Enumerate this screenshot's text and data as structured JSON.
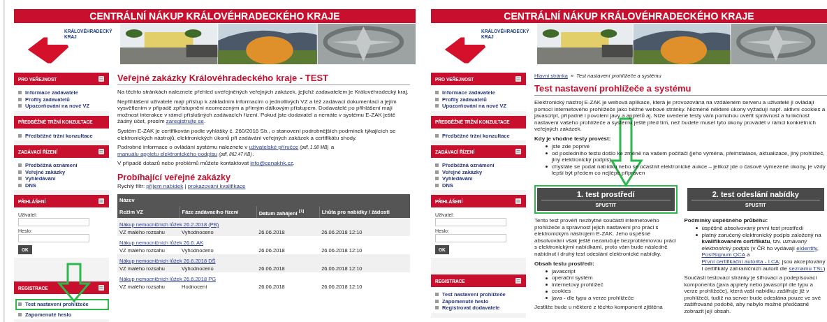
{
  "panels": [
    {
      "header": "CENTRÁLNÍ NÁKUP KRÁLOVÉHRADECKÉHO KRAJE",
      "logo_lines": [
        "KRÁLOVÉHRADECKÝ",
        "KRAJ"
      ],
      "sidebar": [
        {
          "kind": "links",
          "title": "PRO VEŘEJNOST",
          "icon": true,
          "items": [
            {
              "label": "Informace zadavatele",
              "highlighted": false
            },
            {
              "label": "Profily zadavatelů",
              "highlighted": false
            },
            {
              "label": "Upozorňování na nové VZ",
              "highlighted": false
            }
          ]
        },
        {
          "kind": "links",
          "title": "PŘEDBĚŽNÉ TRŽNÍ KONZULTACE",
          "icon": false,
          "items": [
            {
              "label": "Předběžné tržní konzultace",
              "highlighted": false
            }
          ]
        },
        {
          "kind": "links",
          "title": "ZADÁVACÍ ŘÍZENÍ",
          "icon": true,
          "items": [
            {
              "label": "Předběžná oznámení",
              "highlighted": false
            },
            {
              "label": "Veřejné zakázky",
              "highlighted": false
            },
            {
              "label": "Vyhledávání",
              "highlighted": false
            },
            {
              "label": "DNS",
              "highlighted": false
            }
          ]
        },
        {
          "kind": "login",
          "title": "PŘIHLÁŠENÍ",
          "icon": true,
          "fields": [
            {
              "label": "Uživatel:"
            },
            {
              "label": "Heslo:"
            }
          ],
          "button": "OK"
        },
        {
          "kind": "links",
          "title": "REGISTRACE",
          "icon": true,
          "items": [
            {
              "label": "Test nastavení prohlížeče",
              "highlighted": true
            },
            {
              "label": "Zapomenuté heslo",
              "highlighted": false
            }
          ]
        }
      ],
      "content": [
        {
          "kind": "title",
          "text": "Veřejné zakázky Královéhradeckého kraje - TEST"
        },
        {
          "kind": "para",
          "parts": [
            {
              "kind": "text",
              "text": "Na těchto stránkách naleznete přehled uveřejněných veřejných zakázek, jejichž zadavatelem je Královéhradecký kraj."
            }
          ]
        },
        {
          "kind": "para",
          "parts": [
            {
              "kind": "text",
              "text": "Nepřihlášení uživatelé mají přístup k základním informacím o jednotlivých VZ a též zadávací dokumentaci a jejím vysvětlením v případě zpřístupnění neomezeným a přímým dálkovým přístupem. Dodavatelé po přihlášení mají možnost interakce v rámci příslušných zadávacích řízení. Pokud jste dodavatel a nemáte v systému E-ZAK ještě žádný účet, prosím "
            },
            {
              "kind": "link",
              "text": "zaregistrujte se"
            },
            {
              "kind": "text",
              "text": "."
            }
          ]
        },
        {
          "kind": "para",
          "parts": [
            {
              "kind": "text",
              "text": "Systém E-ZAK je certifikován podle vyhlášky č. 260/2016 Sb., o stanovení podrobnějších podmínek týkajících se elektronických nástrojů, elektronických úkonů při zadávání veřejných zakázek a certifikátu shody."
            }
          ]
        },
        {
          "kind": "para",
          "parts": [
            {
              "kind": "text",
              "text": "Podrobné informace o ovládání systému naleznete v "
            },
            {
              "kind": "link",
              "text": "uživatelské příručce"
            },
            {
              "kind": "note",
              "text": "(pdf, 1.98 MB)"
            },
            {
              "kind": "text",
              "text": " a "
            },
            {
              "kind": "link",
              "text": "manuálu appletu elektronického podpisu"
            },
            {
              "kind": "note",
              "text": "(pdf, 862.47 KB)"
            },
            {
              "kind": "text",
              "text": "."
            }
          ]
        },
        {
          "kind": "para",
          "parts": [
            {
              "kind": "text",
              "text": "V případě dotazů nebo problémů můžete kontaktovat "
            },
            {
              "kind": "link",
              "text": "info@cenakhk.cz"
            },
            {
              "kind": "text",
              "text": "."
            }
          ]
        },
        {
          "kind": "subtitle",
          "text": "Probíhající veřejné zakázky"
        },
        {
          "kind": "filter",
          "parts": [
            {
              "kind": "text",
              "text": "Rychlý filtr: "
            },
            {
              "kind": "link",
              "text": "příjem nabídek"
            },
            {
              "kind": "text",
              "text": " | "
            },
            {
              "kind": "link",
              "text": "prokazování kvalifikace"
            }
          ]
        },
        {
          "kind": "table",
          "caption": "Název",
          "columns": [
            "Režim VZ",
            "Fáze zadávacího řízení",
            "Datum zahájení $^{[1]}$",
            "Lhůta pro nabídky / žádosti"
          ],
          "rows": [
            {
              "name": "Nákup nemocničních lůžek 26.2.2018 (PB)",
              "cells": [
                "VZ malého rozsahu",
                "Vyhodnoceno",
                "26.06.2018",
                "26.06.2018 12:10"
              ]
            },
            {
              "name": "Nákup nemocničních lůžek 26.6. AK",
              "cells": [
                "VZ malého rozsahu",
                "Vyhodnoceno",
                "26.06.2018",
                "26.06.2018 12:10"
              ]
            },
            {
              "name": "Nákup nemocničních lůžek 26.6.2018 DŠ",
              "cells": [
                "VZ malého rozsahu",
                "Vyhodnoceno",
                "26.06.2018",
                "26.06.2018 12:10"
              ]
            },
            {
              "name": "Nákup nemocničních lůžek 26.6.2018 PG",
              "cells": [
                "VZ malého rozsahu",
                "Hodnocení",
                "26.06.2018",
                "26.06.2018 12:10"
              ]
            }
          ]
        }
      ]
    },
    {
      "header": "CENTRÁLNÍ NÁKUP KRÁLOVÉHRADECKÉHO KRAJE",
      "logo_lines": [
        "KRÁLOVÉHRADECKÝ",
        "KRAJ"
      ],
      "sidebar": [
        {
          "kind": "links",
          "title": "PRO VEŘEJNOST",
          "icon": true,
          "items": [
            {
              "label": "Informace zadavatele",
              "highlighted": false
            },
            {
              "label": "Profily zadavatelů",
              "highlighted": false
            },
            {
              "label": "Upozorňování na nové VZ",
              "highlighted": false
            }
          ]
        },
        {
          "kind": "links",
          "title": "PŘEDBĚŽNÉ TRŽNÍ KONZULTACE",
          "icon": false,
          "items": [
            {
              "label": "Předběžné tržní konzultace",
              "highlighted": false
            }
          ]
        },
        {
          "kind": "links",
          "title": "ZADÁVACÍ ŘÍZENÍ",
          "icon": true,
          "items": [
            {
              "label": "Předběžná oznámení",
              "highlighted": false
            },
            {
              "label": "Veřejné zakázky",
              "highlighted": false
            },
            {
              "label": "Vyhledávání",
              "highlighted": false
            },
            {
              "label": "DNS",
              "highlighted": false
            }
          ]
        },
        {
          "kind": "login",
          "title": "PŘIHLÁŠENÍ",
          "icon": true,
          "fields": [
            {
              "label": "Uživatel:"
            },
            {
              "label": "Heslo:"
            }
          ],
          "button": "OK"
        },
        {
          "kind": "links",
          "title": "REGISTRACE",
          "icon": true,
          "items": [
            {
              "label": "Test nastavení prohlížeče",
              "highlighted": false
            },
            {
              "label": "Zapomenuté heslo",
              "highlighted": false
            },
            {
              "label": "Registrovat dodavatele",
              "highlighted": false
            }
          ]
        }
      ],
      "content": [
        {
          "kind": "breadcrumb",
          "link": "Hlavní stránka",
          "separator": "»",
          "current": "Test nastavení prohlížeče a systému"
        },
        {
          "kind": "title",
          "text": "Test nastavení prohlížeče a systému"
        },
        {
          "kind": "para",
          "parts": [
            {
              "kind": "text",
              "text": "Elektronický nástroj E-ZAK je webová aplikace, která je provozována na vzdáleném serveru a uživatelé ji ovládají pomocí internetového prohlížeče jako běžné webové stránky. Nicméně některé úkony vyžadují např. aktivní cookies a javascript, případně i povolení javy a appletů aj. Níže uvedené testy vám pomohou ověřit správnost a funkčnost nastavení vašeho prohlížeče a systému ještě před tím, než budete muset tyto úkony provádět v rámci konkrétních veřejných zakázek."
            }
          ]
        },
        {
          "kind": "label",
          "text": "Kdy je vhodné testy provést:"
        },
        {
          "kind": "list",
          "items": [
            "jste zde poprvé",
            "od posledního testu došlo ke změně na vašem počítači (jeho výměna, přeinstalace, aktualizace, jiný prohlížeč, jiný elektronický podpis)",
            "chystáte se podat nabídku nebo se účastnit elektronické aukce – jelikož jde o časově vymezené úkony, je vždy lepší být předem co nejlépe připraven"
          ]
        },
        {
          "kind": "tests",
          "columns": [
            {
              "title": "1. test prostředí",
              "button": "SPUSTIT",
              "highlighted": true,
              "blocks": [
                {
                  "kind": "para",
                  "parts": [
                    {
                      "kind": "text",
                      "text": "Tento test prověří nezbytné součásti internetového prohlížeče a správnost jejich nastavení pro práci s elektronickým nástrojem E-ZAK. Jeho úspěšné absolvování však ještě nezaručuje bezproblémovou práci s elektronickými nabídkami, proto vám bude následně nabídnut i druhý test odeslání elektronické nabídky."
                    }
                  ]
                },
                {
                  "kind": "label",
                  "text": "Obsah testu prostředí:"
                },
                {
                  "kind": "list",
                  "items": [
                    "javascript",
                    "operační systém",
                    "internetový prohlížeč",
                    "cookies",
                    "java - dle typu a verze prohlížeče"
                  ]
                },
                {
                  "kind": "para",
                  "parts": [
                    {
                      "kind": "text",
                      "text": "Jestliže bude u některé z těchto komponent zjištěna"
                    }
                  ]
                }
              ]
            },
            {
              "title": "2. test odeslání nabídky",
              "button": "SPUSTIT",
              "highlighted": false,
              "blocks": [
                {
                  "kind": "label",
                  "text": "Podmínky úspěšného průběhu:"
                },
                {
                  "kind": "list",
                  "items": [
                    "úspěšně absolvovaný první test prostředí",
                    {
                      "parts": [
                        {
                          "kind": "text",
                          "text": "platný zaručený elektronický podpis založený na **kvalifikovaném certifikátu**, tzv. *uznávaný elektronický podpis* (v ČR ho vydávají "
                        },
                        {
                          "kind": "link",
                          "text": "eIdentity"
                        },
                        {
                          "kind": "text",
                          "text": ", "
                        },
                        {
                          "kind": "link",
                          "text": "PostSignum QCA"
                        },
                        {
                          "kind": "text",
                          "text": " a "
                        },
                        {
                          "kind": "link",
                          "text": "První certifikační autorita - I.CA"
                        },
                        {
                          "kind": "text",
                          "text": "; jsou akceptovány i certifikáty zahraničních autorit dle "
                        },
                        {
                          "kind": "link",
                          "text": "seznamu TSL"
                        },
                        {
                          "kind": "text",
                          "text": ")"
                        }
                      ]
                    }
                  ]
                },
                {
                  "kind": "para",
                  "parts": [
                    {
                      "kind": "text",
                      "text": "Součástí testovací stránky je šifrovací a podepisovací komponenta (java applety nebo javascript dle typu a verze prohlížeče), která vaši nabídku zašifruje již v prohlížeči, tudíž na server bude odeslána pouze ve své zašifrované podobě, aby nebylo možné předčasně zobrazit její obsah."
                    }
                  ]
                }
              ]
            }
          ]
        }
      ]
    }
  ]
}
